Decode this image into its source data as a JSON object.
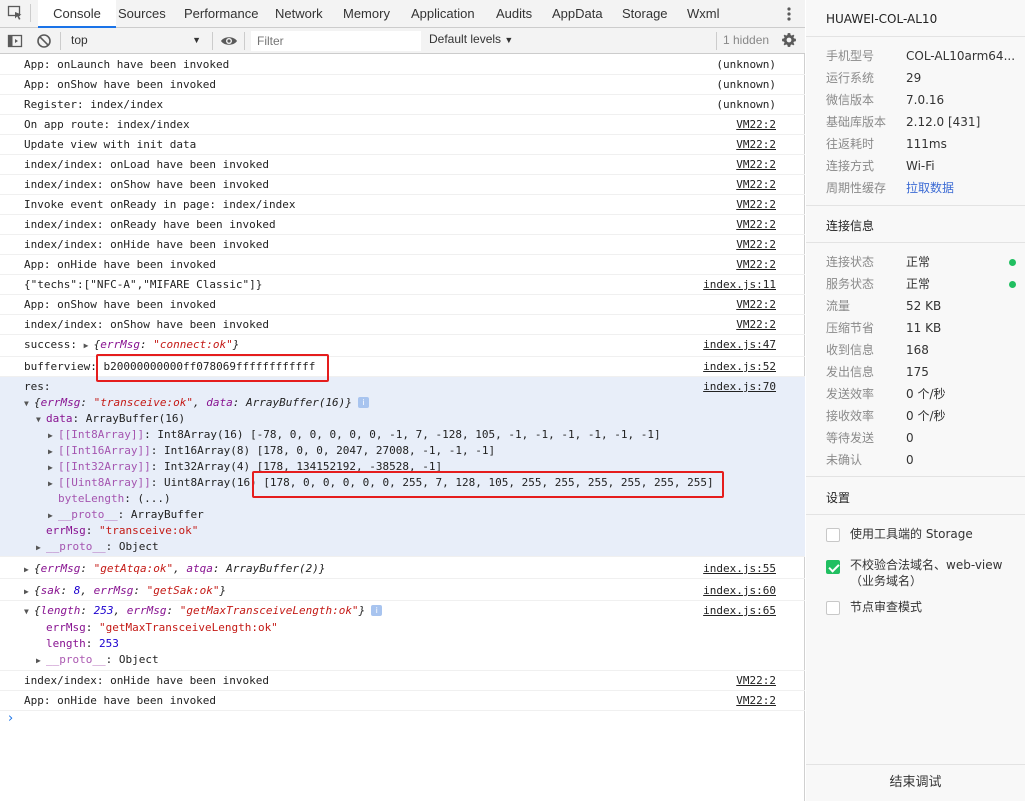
{
  "tabs": [
    "Console",
    "Sources",
    "Performance",
    "Network",
    "Memory",
    "Application",
    "Audits",
    "AppData",
    "Storage",
    "Wxml"
  ],
  "toolbar": {
    "context": "top",
    "filter_placeholder": "Filter",
    "levels": "Default levels",
    "hidden": "1 hidden"
  },
  "logs": [
    {
      "msg": "App: onLaunch have been invoked",
      "src": "(unknown)"
    },
    {
      "msg": "App: onShow have been invoked",
      "src": "(unknown)"
    },
    {
      "msg": "Register: index/index",
      "src": "(unknown)"
    },
    {
      "msg": "On app route: index/index",
      "src": "VM22:2"
    },
    {
      "msg": "Update view with init data",
      "src": "VM22:2"
    },
    {
      "msg": "index/index: onLoad have been invoked",
      "src": "VM22:2"
    },
    {
      "msg": "index/index: onShow have been invoked",
      "src": "VM22:2"
    },
    {
      "msg": "Invoke event onReady in page: index/index",
      "src": "VM22:2"
    },
    {
      "msg": "index/index: onReady have been invoked",
      "src": "VM22:2"
    },
    {
      "msg": "index/index: onHide have been invoked",
      "src": "VM22:2"
    },
    {
      "msg": "App: onHide have been invoked",
      "src": "VM22:2"
    },
    {
      "msg": "{\"techs\":[\"NFC-A\",\"MIFARE Classic\"]}",
      "src": "index.js:11"
    },
    {
      "msg": "App: onShow have been invoked",
      "src": "VM22:2"
    },
    {
      "msg": "index/index: onShow have been invoked",
      "src": "VM22:2"
    }
  ],
  "success": {
    "label": "success:",
    "obj_open": "{",
    "key": "errMsg",
    "val": "\"connect:ok\"",
    "obj_close": "}",
    "src": "index.js:47"
  },
  "bufferview": {
    "label": "bufferview:",
    "value": "b20000000000ff078069ffffffffffff",
    "src": "index.js:52"
  },
  "res": {
    "label": "res:",
    "src": "index.js:70",
    "summary_key1": "errMsg",
    "summary_val1": "\"transceive:ok\"",
    "summary_key2": "data",
    "summary_val2": "ArrayBuffer(16)",
    "data_label": "data",
    "data_type": "ArrayBuffer(16)",
    "int8_key": "[[Int8Array]]",
    "int8_type": "Int8Array(16)",
    "int8_vals": "[-78, 0, 0, 0, 0, 0, -1, 7, -128, 105, -1, -1, -1, -1, -1, -1]",
    "int16_key": "[[Int16Array]]",
    "int16_type": "Int16Array(8)",
    "int16_vals": "[178, 0, 0, 2047, 27008, -1, -1, -1]",
    "int32_key": "[[Int32Array]]",
    "int32_type": "Int32Array(4)",
    "int32_vals": "[178, 134152192, -38528, -1]",
    "uint8_key": "[[Uint8Array]]",
    "uint8_type": "Uint8Array(16)",
    "uint8_vals": "[178, 0, 0, 0, 0, 0, 255, 7, 128, 105, 255, 255, 255, 255, 255, 255]",
    "bytelength_key": "byteLength",
    "bytelength_val": "(...)",
    "proto1_key": "__proto__",
    "proto1_val": "ArrayBuffer",
    "errmsg_key": "errMsg",
    "errmsg_val": "\"transceive:ok\"",
    "proto2_key": "__proto__",
    "proto2_val": "Object"
  },
  "atqa": {
    "k1": "errMsg",
    "v1": "\"getAtqa:ok\"",
    "k2": "atqa",
    "v2": "ArrayBuffer(2)",
    "src": "index.js:55"
  },
  "sak": {
    "k1": "sak",
    "v1": "8",
    "k2": "errMsg",
    "v2": "\"getSak:ok\"",
    "src": "index.js:60"
  },
  "maxlen": {
    "k1": "length",
    "v1": "253",
    "k2": "errMsg",
    "v2": "\"getMaxTransceiveLength:ok\"",
    "src": "index.js:65",
    "errmsg_key": "errMsg",
    "errmsg_val": "\"getMaxTransceiveLength:ok\"",
    "length_key": "length",
    "length_val": "253",
    "proto_key": "__proto__",
    "proto_val": "Object"
  },
  "tail_logs": [
    {
      "msg": "index/index: onHide have been invoked",
      "src": "VM22:2"
    },
    {
      "msg": "App: onHide have been invoked",
      "src": "VM22:2"
    }
  ],
  "prompt": "›",
  "panel": {
    "title": "HUAWEI-COL-AL10",
    "device": [
      {
        "k": "手机型号",
        "v": "COL-AL10arm64..."
      },
      {
        "k": "运行系统",
        "v": "29"
      },
      {
        "k": "微信版本",
        "v": "7.0.16"
      },
      {
        "k": "基础库版本",
        "v": "2.12.0 [431]"
      },
      {
        "k": "往返耗时",
        "v": "111ms"
      },
      {
        "k": "连接方式",
        "v": "Wi-Fi"
      },
      {
        "k": "周期性缓存",
        "v": "拉取数据"
      }
    ],
    "conn_title": "连接信息",
    "conn": [
      {
        "k": "连接状态",
        "v": "正常"
      },
      {
        "k": "服务状态",
        "v": "正常"
      },
      {
        "k": "流量",
        "v": "52 KB"
      },
      {
        "k": "压缩节省",
        "v": "11 KB"
      },
      {
        "k": "收到信息",
        "v": "168"
      },
      {
        "k": "发出信息",
        "v": "175"
      },
      {
        "k": "发送效率",
        "v": "0 个/秒"
      },
      {
        "k": "接收效率",
        "v": "0 个/秒"
      },
      {
        "k": "等待发送",
        "v": "0"
      },
      {
        "k": "未确认",
        "v": "0"
      }
    ],
    "settings_title": "设置",
    "settings": [
      {
        "label": "使用工具端的 Storage",
        "checked": false
      },
      {
        "label": "不校验合法域名、web-view（业务域名）",
        "checked": true
      },
      {
        "label": "节点审查模式",
        "checked": false
      }
    ],
    "end_button": "结束调试",
    "status_color": "#21bf61"
  }
}
